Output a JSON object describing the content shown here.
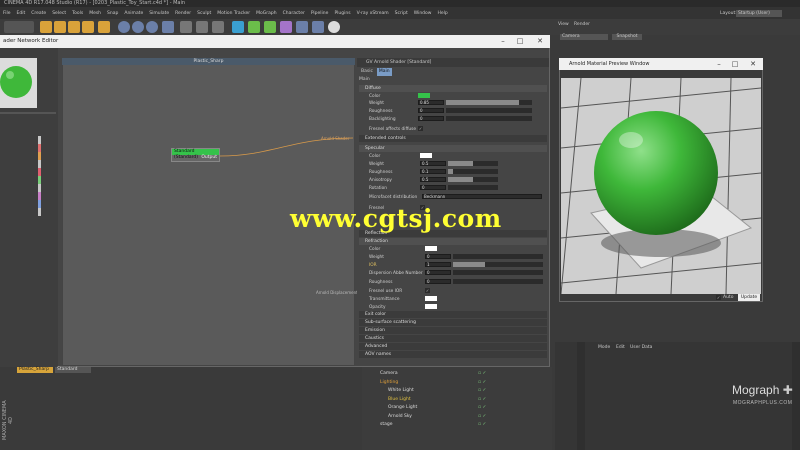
{
  "app": {
    "title": "CINEMA 4D R17.048 Studio (R17) - [0203_Plastic_Toy_Start.c4d *] - Main"
  },
  "menu": [
    "File",
    "Edit",
    "Create",
    "Select",
    "Tools",
    "Mesh",
    "Snap",
    "Animate",
    "Simulate",
    "Render",
    "Sculpt",
    "Motion Tracker",
    "MoGraph",
    "Character",
    "Pipeline",
    "Plugins",
    "V-ray xStream",
    "Script",
    "Window",
    "Help"
  ],
  "layout": {
    "label": "Layout:",
    "value": "Startup (User)"
  },
  "toolbar_right": {
    "view": "View",
    "render": "Render",
    "camera": "Camera",
    "snapshot": "Snapshot"
  },
  "node_editor": {
    "title": "ader Network Editor",
    "canvas_title": "Plastic_Sharp",
    "node_title": "Standard (Standard)",
    "node_output": "Output",
    "port_arnold": "Arnold Shader",
    "port_displacement": "Arnold Displacement"
  },
  "attributes": {
    "header": "GV Arnold Shader [Standard]",
    "tabs": [
      "Basic",
      "Main"
    ],
    "main_label": "Main",
    "diffuse": {
      "title": "Diffuse",
      "color": "Color",
      "weight": "Weight",
      "weight_value": "0.85",
      "roughness": "Roughness",
      "roughness_value": "0",
      "backlighting": "Backlighting",
      "backlighting_value": "0",
      "fresnel": "Fresnel affects diffuse",
      "extended": "Extended controls"
    },
    "specular": {
      "title": "Specular",
      "color": "Color",
      "weight": "Weight",
      "weight_value": "0.5",
      "roughness": "Roughness",
      "roughness_value": "0.1",
      "anisotropy": "Anisotropy",
      "anisotropy_value": "0.5",
      "rotation": "Rotation",
      "rotation_value": "0",
      "microfacet": "Microfacet distribution",
      "microfacet_value": "Beckmann",
      "fresnel": "Fresnel"
    },
    "reflection": "Reflection",
    "refraction": {
      "title": "Refraction",
      "color": "Color",
      "weight": "Weight",
      "weight_value": "0",
      "ior": "IOR",
      "ior_value": "1",
      "abbe": "Dispersion Abbe Number",
      "abbe_value": "0",
      "roughness": "Roughness",
      "roughness_value": "0",
      "fresnel_ior": "Fresnel use IOR",
      "transmittance": "Transmittance",
      "opacity": "Opacity",
      "exit_color": "Exit color"
    },
    "collapsed": [
      "Sub-surface scattering",
      "Emission",
      "Caustics",
      "Advanced",
      "AOV names"
    ]
  },
  "preview": {
    "title": "Arnold Material Preview Window",
    "auto": "Auto",
    "update": "Update"
  },
  "materials": [
    "Plastic_Sharp",
    "Standard"
  ],
  "objects": [
    {
      "name": "Camera",
      "color": "#dddddd"
    },
    {
      "name": "Lighting",
      "color": "#e0a03a"
    },
    {
      "name": "White Light",
      "color": "#dddddd"
    },
    {
      "name": "Blue Light",
      "color": "#e0c040"
    },
    {
      "name": "Orange Light",
      "color": "#dddddd"
    },
    {
      "name": "Arnold Sky",
      "color": "#dddddd"
    },
    {
      "name": "stage",
      "color": "#dddddd"
    }
  ],
  "attr_manager_menu": [
    "Mode",
    "Edit",
    "User Data"
  ],
  "watermark": "www.cgtsj.com",
  "brand": {
    "name": "Mograph",
    "sub": "MOGRAPHPLUS.COM",
    "maxon": "MAXON CINEMA 4D"
  },
  "colors": {
    "accent_green": "#35c24a",
    "sphere_green": "#3fb83a",
    "material_active": "#d7a43a"
  }
}
